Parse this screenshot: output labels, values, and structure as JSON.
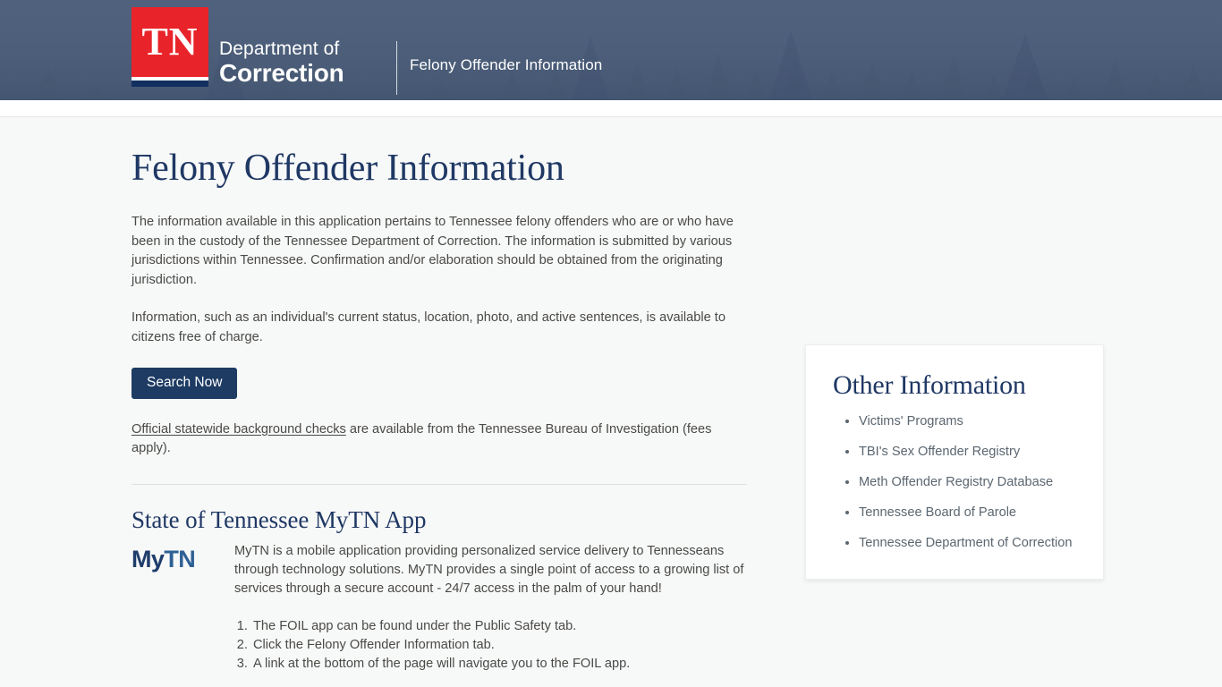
{
  "header": {
    "logo_text": "TN",
    "dept_line1": "Department of",
    "dept_line2": "Correction",
    "subtitle": "Felony Offender Information",
    "bg_color": "#4c5e79",
    "logo_red": "#e8242a",
    "logo_navy": "#12305f"
  },
  "main": {
    "title": "Felony Offender Information",
    "paragraph1": "The information available in this application pertains to Tennessee felony offenders who are or who have been in the custody of the Tennessee Department of Correction. The information is submitted by various jurisdictions within Tennessee. Confirmation and/or elaboration should be obtained from the originating jurisdiction.",
    "paragraph2": "Information, such as an individual's current status, location, photo, and active sentences, is available to citizens free of charge.",
    "search_button_label": "Search Now",
    "search_button_color": "#1d3b63",
    "background_link_text": "Official statewide background checks",
    "background_rest_text": " are available from the Tennessee Bureau of Investigation (fees apply)."
  },
  "mytn": {
    "section_title": "State of Tennessee MyTN App",
    "logo_part1": "My",
    "logo_part2": "TN",
    "description": "MyTN is a mobile application providing personalized service delivery to Tennesseans through technology solutions. MyTN provides a single point of access to a growing list of services through a secure account - 24/7 access in the palm of your hand!",
    "steps": [
      "The FOIL app can be found under the Public Safety tab.",
      "Click the Felony Offender Information tab.",
      "A link at the bottom of the page will navigate you to the FOIL app."
    ]
  },
  "sidebar": {
    "title": "Other Information",
    "links": [
      "Victims' Programs",
      "TBI's Sex Offender Registry",
      "Meth Offender Registry Database",
      "Tennessee Board of Parole",
      "Tennessee Department of Correction"
    ]
  }
}
